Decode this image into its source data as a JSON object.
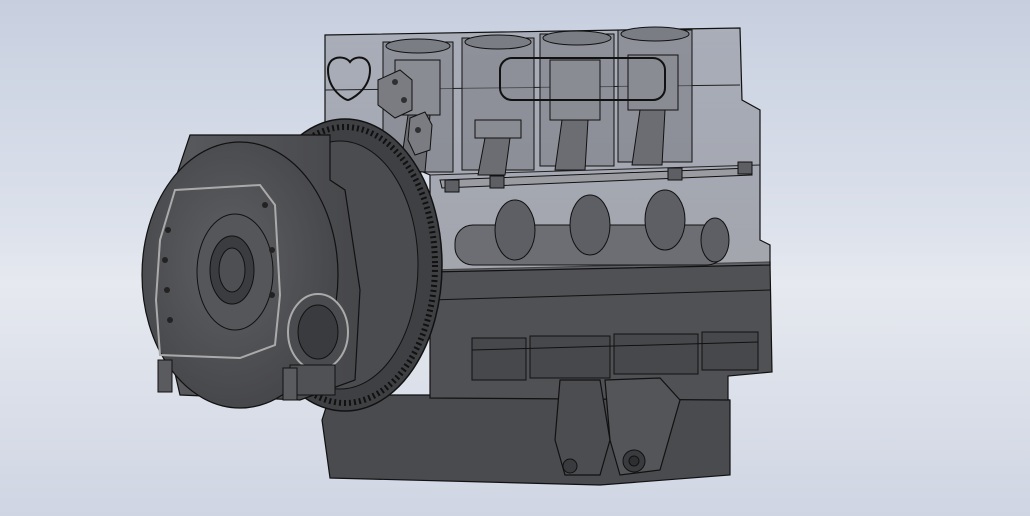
{
  "viewport": {
    "background_top": "#c7cfdf",
    "background_bottom": "#e6e9ef"
  },
  "model": {
    "body_color": "#505154",
    "body_dark": "#3e3f42",
    "body_light": "#6a6b6f",
    "transparent_block": "rgba(150,152,160,0.45)",
    "edge_color": "#111111",
    "cylinder_count": 4,
    "flywheel_teeth": 96
  }
}
